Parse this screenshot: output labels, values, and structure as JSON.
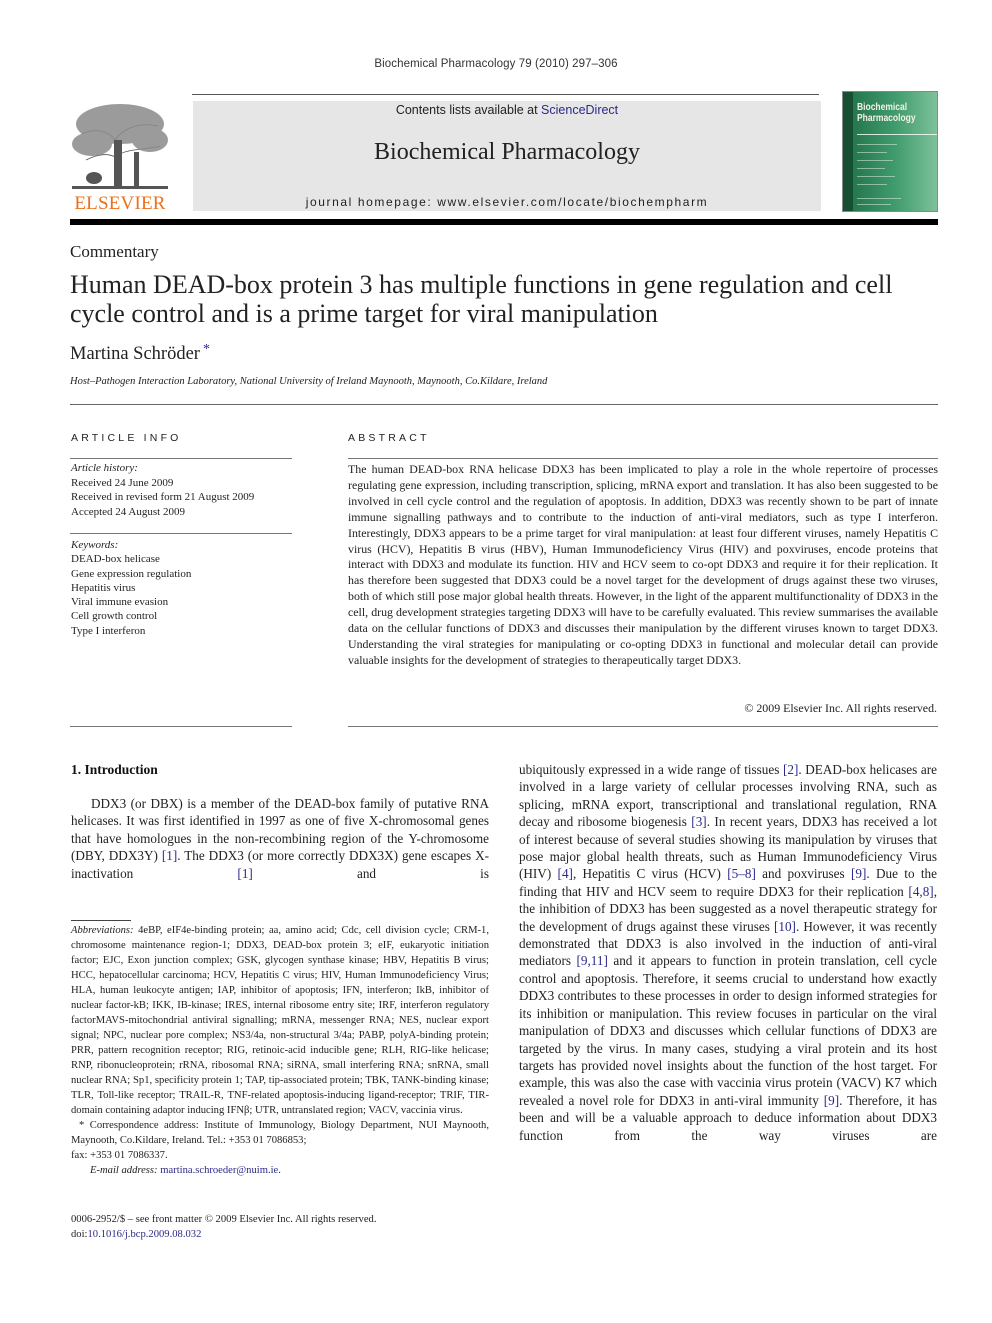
{
  "running_head": "Biochemical Pharmacology 79 (2010) 297–306",
  "masthead": {
    "publisher_logo_text": "ELSEVIER",
    "publisher_logo_icon": "elsevier-tree-icon",
    "contents_prefix": "Contents lists available at ",
    "contents_link": "ScienceDirect",
    "journal_title": "Biochemical Pharmacology",
    "homepage_line": "journal homepage: www.elsevier.com/locate/biochempharm",
    "cover": {
      "line1": "Biochemical",
      "line2": "Pharmacology",
      "icon": "journal-cover-thumbnail"
    },
    "colors": {
      "logo_orange": "#e9711c",
      "banner_gray": "#e6e6e6",
      "link_blue": "#2a2a8a",
      "cover_green": "#2f8a5a"
    }
  },
  "article": {
    "type": "Commentary",
    "title": "Human DEAD-box protein 3 has multiple functions in gene regulation and cell cycle control and is a prime target for viral manipulation",
    "author": "Martina Schröder",
    "author_mark": "*",
    "affiliation": "Host–Pathogen Interaction Laboratory, National University of Ireland Maynooth, Maynooth, Co.Kildare, Ireland"
  },
  "article_info": {
    "label": "ARTICLE INFO",
    "history_label": "Article history:",
    "history": [
      "Received 24 June 2009",
      "Received in revised form 21 August 2009",
      "Accepted 24 August 2009"
    ],
    "keywords_label": "Keywords:",
    "keywords": [
      "DEAD-box helicase",
      "Gene expression regulation",
      "Hepatitis virus",
      "Viral immune evasion",
      "Cell growth control",
      "Type I interferon"
    ]
  },
  "abstract": {
    "label": "ABSTRACT",
    "text": "The human DEAD-box RNA helicase DDX3 has been implicated to play a role in the whole repertoire of processes regulating gene expression, including transcription, splicing, mRNA export and translation. It has also been suggested to be involved in cell cycle control and the regulation of apoptosis. In addition, DDX3 was recently shown to be part of innate immune signalling pathways and to contribute to the induction of anti-viral mediators, such as type I interferon. Interestingly, DDX3 appears to be a prime target for viral manipulation: at least four different viruses, namely Hepatitis C virus (HCV), Hepatitis B virus (HBV), Human Immunodeficiency Virus (HIV) and poxviruses, encode proteins that interact with DDX3 and modulate its function. HIV and HCV seem to co-opt DDX3 and require it for their replication. It has therefore been suggested that DDX3 could be a novel target for the development of drugs against these two viruses, both of which still pose major global health threats. However, in the light of the apparent multifunctionality of DDX3 in the cell, drug development strategies targeting DDX3 will have to be carefully evaluated. This review summarises the available data on the cellular functions of DDX3 and discusses their manipulation by the different viruses known to target DDX3. Understanding the viral strategies for manipulating or co-opting DDX3 in functional and molecular detail can provide valuable insights for the development of strategies to therapeutically target DDX3.",
    "copyright": "© 2009 Elsevier Inc. All rights reserved."
  },
  "body": {
    "section_heading": "1.  Introduction",
    "col1": [
      {
        "t": "DDX3 (or DBX) is a member of the DEAD-box family of putative RNA helicases. It was first identified in 1997 as one of five X-chromosomal genes that have homologues in the non-recombining region of the Y-chromosome (DBY, DDX3Y) "
      },
      {
        "ref": "[1]"
      },
      {
        "t": ". The DDX3 (or more correctly DDX3X) gene escapes X-inactivation "
      },
      {
        "ref": "[1]"
      },
      {
        "t": " and is"
      }
    ],
    "col2": [
      {
        "t": "ubiquitously expressed in a wide range of tissues "
      },
      {
        "ref": "[2]"
      },
      {
        "t": ". DEAD-box helicases are involved in a large variety of cellular processes involving RNA, such as splicing, mRNA export, transcriptional and translational regulation, RNA decay and ribosome biogenesis "
      },
      {
        "ref": "[3]"
      },
      {
        "t": ". In recent years, DDX3 has received a lot of interest because of several studies showing its manipulation by viruses that pose major global health threats, such as Human Immunodeficiency Virus (HIV) "
      },
      {
        "ref": "[4]"
      },
      {
        "t": ", Hepatitis C virus (HCV) "
      },
      {
        "ref": "[5–8]"
      },
      {
        "t": " and poxviruses "
      },
      {
        "ref": "[9]"
      },
      {
        "t": ". Due to the finding that HIV and HCV seem to require DDX3 for their replication "
      },
      {
        "ref": "[4,8]"
      },
      {
        "t": ", the inhibition of DDX3 has been suggested as a novel therapeutic strategy for the development of drugs against these viruses "
      },
      {
        "ref": "[10]"
      },
      {
        "t": ". However, it was recently demonstrated that DDX3 is also involved in the induction of anti-viral mediators "
      },
      {
        "ref": "[9,11]"
      },
      {
        "t": " and it appears to function in protein translation, cell cycle control and apoptosis. Therefore, it seems crucial to understand how exactly DDX3 contributes to these processes in order to design informed strategies for its inhibition or manipulation. This review focuses in particular on the viral manipulation of DDX3 and discusses which cellular functions of DDX3 are targeted by the virus. In many cases, studying a viral protein and its host targets has provided novel insights about the function of the host target. For example, this was also the case with vaccinia virus protein (VACV) K7 which revealed a novel role for DDX3 in anti-viral immunity "
      },
      {
        "ref": "[9]"
      },
      {
        "t": ". Therefore, it has been and will be a valuable approach to deduce information about DDX3 function from the way viruses are"
      }
    ]
  },
  "footnotes": {
    "abbrev_label": "Abbreviations:",
    "abbrev_text": " 4eBP, eIF4e-binding protein; aa, amino acid; Cdc, cell division cycle; CRM-1, chromosome maintenance region-1; DDX3, DEAD-box protein 3; eIF, eukaryotic initiation factor; EJC, Exon junction complex; GSK, glycogen synthase kinase; HBV, Hepatitis B virus; HCC, hepatocellular carcinoma; HCV, Hepatitis C virus; HIV, Human Immunodeficiency Virus; HLA, human leukocyte antigen; IAP, inhibitor of apoptosis; IFN, interferon; IkB, inhibitor of nuclear factor-kB; IKK, IB-kinase; IRES, internal ribosome entry site; IRF, interferon regulatory factorMAVS-mitochondrial antiviral signalling; mRNA, messenger RNA; NES, nuclear export signal; NPC, nuclear pore complex; NS3/4a, non-structural 3/4a; PABP, polyA-binding protein; PRR, pattern recognition receptor; RIG, retinoic-acid inducible gene; RLH, RIG-like helicase; RNP, ribonucleoprotein; rRNA, ribosomal RNA; siRNA, small interfering RNA; snRNA, small nuclear RNA; Sp1, specificity protein 1; TAP, tip-associated protein; TBK, TANK-binding kinase; TLR, Toll-like receptor; TRAIL-R, TNF-related apoptosis-inducing ligand-receptor; TRIF, TIR-domain containing adaptor inducing IFNβ; UTR, untranslated region; VACV, vaccinia virus.",
    "correspondence_line1": "* Correspondence address: Institute of Immunology, Biology Department, NUI Maynooth, Maynooth, Co.Kildare, Ireland. Tel.: +353 01 7086853;",
    "correspondence_line2": "fax: +353 01 7086337.",
    "email_label": "E-mail address: ",
    "email": "martina.schroeder@nuim.ie",
    "email_suffix": "."
  },
  "front_matter": {
    "line1": "0006-2952/$ – see front matter © 2009 Elsevier Inc. All rights reserved.",
    "doi_prefix": "doi:",
    "doi": "10.1016/j.bcp.2009.08.032"
  }
}
